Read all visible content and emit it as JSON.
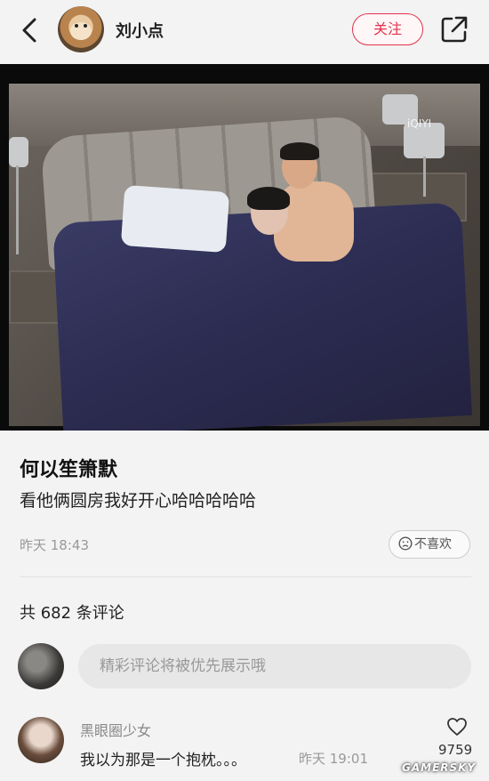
{
  "header": {
    "username": "刘小点",
    "follow_label": "关注"
  },
  "video": {
    "logo_text": "iQIYI"
  },
  "post": {
    "title": "何以笙箫默",
    "body": "看他俩圆房我好开心哈哈哈哈哈",
    "time": "昨天 18:43",
    "dislike_label": "不喜欢"
  },
  "comments": {
    "count_label": "共 682 条评论",
    "input_placeholder": "精彩评论将被优先展示哦",
    "items": [
      {
        "name": "黑眼圈少女",
        "text": "我以为那是一个抱枕。。。",
        "time": "昨天 19:01",
        "likes": "9759"
      }
    ]
  },
  "watermark": "GAMERSKY",
  "icons": [
    "back-icon",
    "share-icon",
    "dislike-face-icon",
    "heart-icon"
  ],
  "colors": {
    "accent": "#e2334b",
    "background": "#f3f3f3"
  }
}
